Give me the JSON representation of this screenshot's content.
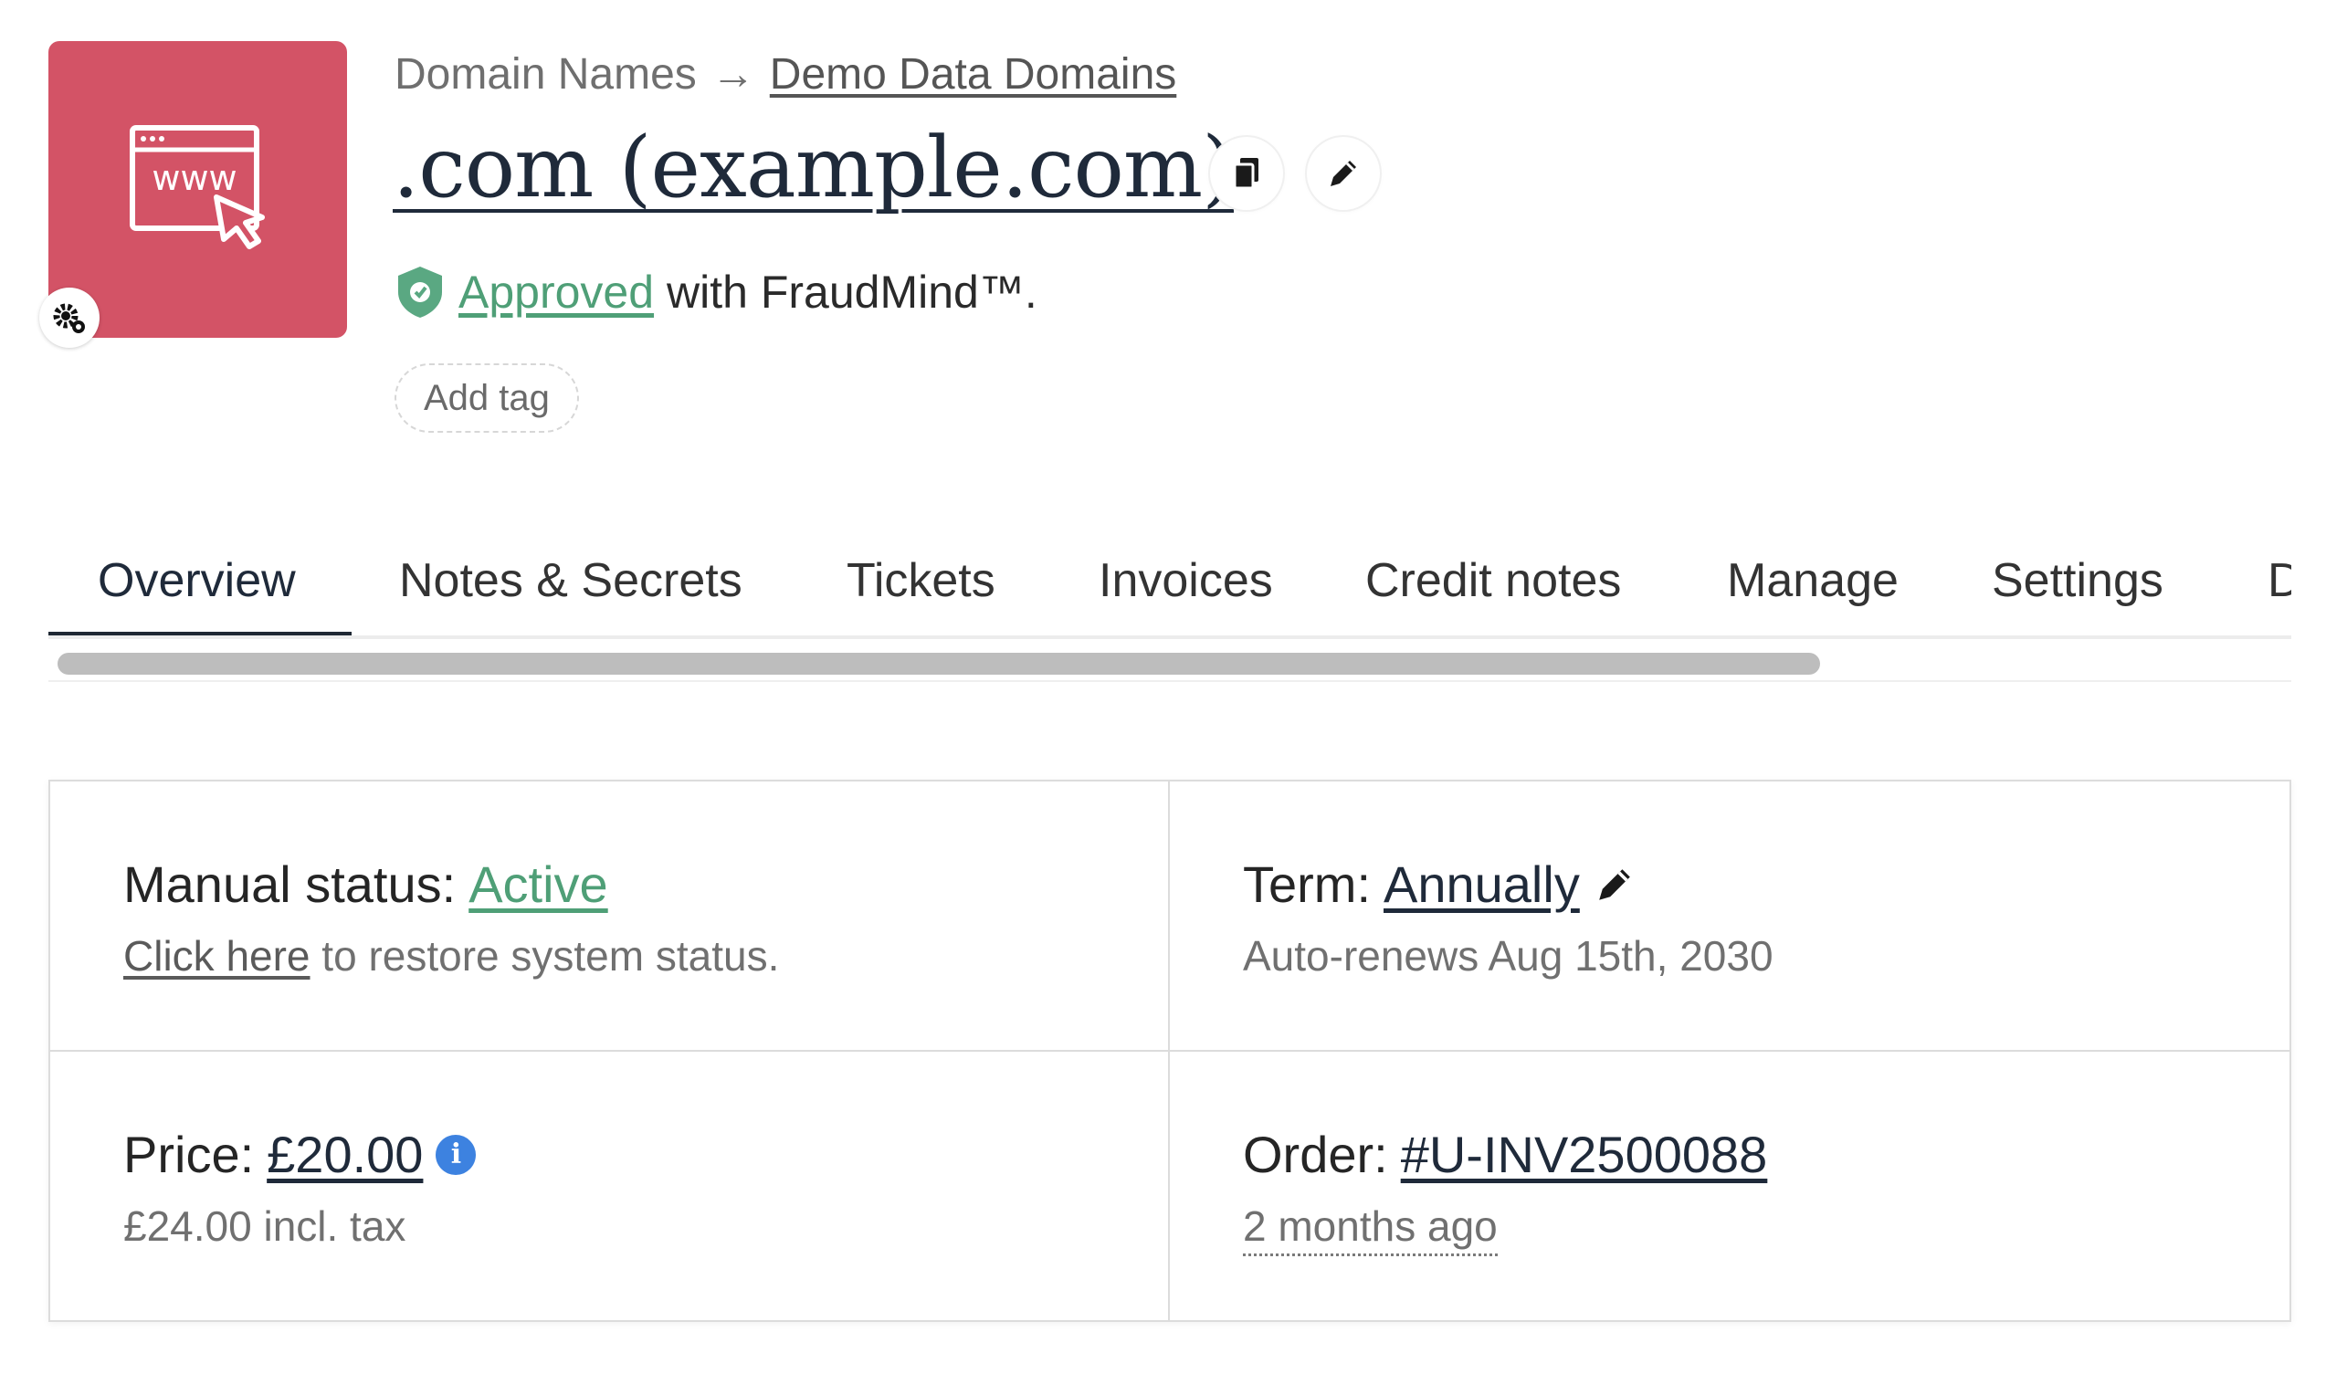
{
  "header": {
    "breadcrumb_root": "Domain Names",
    "breadcrumb_arrow": "→",
    "breadcrumb_link": "Demo Data Domains",
    "title": ".com (example.com)",
    "product_image_text": "www",
    "approval_status": "Approved",
    "approval_suffix": "with FraudMind™.",
    "add_tag_label": "Add tag"
  },
  "tabs": [
    {
      "label": "Overview",
      "active": true
    },
    {
      "label": "Notes & Secrets"
    },
    {
      "label": "Tickets"
    },
    {
      "label": "Invoices"
    },
    {
      "label": "Credit notes"
    },
    {
      "label": "Manage"
    },
    {
      "label": "Settings"
    },
    {
      "label": "D"
    }
  ],
  "overview": {
    "manual_status_label": "Manual status:",
    "manual_status_value": "Active",
    "restore_link": "Click here",
    "restore_text": "to restore system status.",
    "term_label": "Term:",
    "term_value": "Annually",
    "auto_renew": "Auto-renews Aug 15th, 2030",
    "price_label": "Price:",
    "price_value": "£20.00",
    "price_incl_tax": "£24.00 incl. tax",
    "order_label": "Order:",
    "order_value": "#U-INV2500088",
    "order_time": "2 months ago"
  },
  "colors": {
    "product_bg": "#d35366",
    "approved_green": "#4f9f77",
    "info_blue": "#3d82e0",
    "active_tab": "#1e2733"
  },
  "icons": {
    "product": "browser-www-cursor-icon",
    "badge": "gear-icon",
    "copy": "copy-icon",
    "edit": "pencil-icon",
    "shield": "shield-check-icon",
    "info": "info-icon"
  }
}
